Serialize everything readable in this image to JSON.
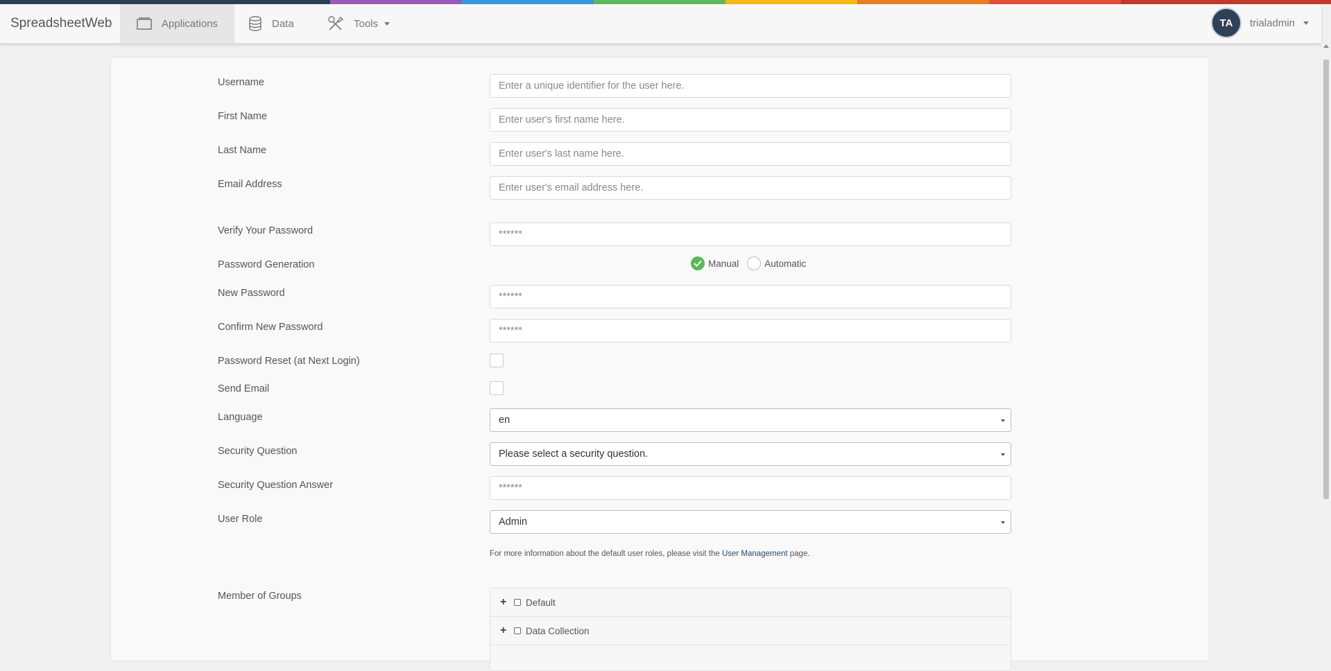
{
  "strip_colors": [
    "#2d3e50",
    "#9b59b6",
    "#3498db",
    "#5cb85c",
    "#f5b914",
    "#e67e22",
    "#e74c3c",
    "#c0392b"
  ],
  "navbar": {
    "brand": "SpreadsheetWeb",
    "items": [
      {
        "label": "Applications",
        "icon": "window-icon",
        "active": true
      },
      {
        "label": "Data",
        "icon": "database-icon"
      },
      {
        "label": "Tools",
        "icon": "tools-icon"
      }
    ],
    "user": {
      "initials": "TA",
      "name": "trialadmin"
    }
  },
  "form": {
    "username": {
      "label": "Username",
      "placeholder": "Enter a unique identifier for the user here."
    },
    "first_name": {
      "label": "First Name",
      "placeholder": "Enter user's first name here."
    },
    "last_name": {
      "label": "Last Name",
      "placeholder": "Enter user's last name here."
    },
    "email": {
      "label": "Email Address",
      "placeholder": "Enter user's email address here."
    },
    "verify_password": {
      "label": "Verify Your Password",
      "placeholder": "******"
    },
    "password_generation": {
      "label": "Password Generation",
      "options": [
        "Manual",
        "Automatic"
      ],
      "selected": "Manual"
    },
    "new_password": {
      "label": "New Password",
      "placeholder": "******"
    },
    "confirm_password": {
      "label": "Confirm New Password",
      "placeholder": "******"
    },
    "password_reset": {
      "label": "Password Reset (at Next Login)",
      "checked": false
    },
    "send_email": {
      "label": "Send Email",
      "checked": false
    },
    "language": {
      "label": "Language",
      "value": "en"
    },
    "security_question": {
      "label": "Security Question",
      "value": "Please select a security question."
    },
    "security_answer": {
      "label": "Security Question Answer",
      "placeholder": "******"
    },
    "user_role": {
      "label": "User Role",
      "value": "Admin"
    },
    "role_help": {
      "prefix": "For more information about the default user roles, please visit the ",
      "link": "User Management",
      "suffix": " page."
    },
    "groups": {
      "label": "Member of Groups",
      "items": [
        "Default",
        "Data Collection"
      ]
    }
  }
}
